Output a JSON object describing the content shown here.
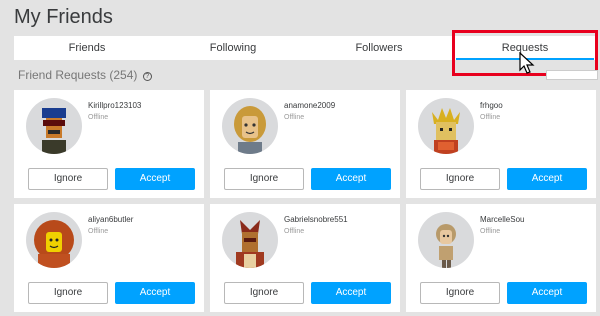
{
  "header": {
    "title": "My Friends"
  },
  "tabs": [
    {
      "label": "Friends"
    },
    {
      "label": "Following"
    },
    {
      "label": "Followers"
    },
    {
      "label": "Requests",
      "active": true
    }
  ],
  "section": {
    "title": "Friend Requests (254)",
    "help_glyph": "?"
  },
  "buttons": {
    "ignore": "Ignore",
    "accept": "Accept"
  },
  "requests": [
    {
      "username": "Kirillpro123103",
      "status": "Offline"
    },
    {
      "username": "anamone2009",
      "status": "Offline"
    },
    {
      "username": "frhgoo",
      "status": "Offline"
    },
    {
      "username": "aliyan6butler",
      "status": "Offline"
    },
    {
      "username": "Gabrielsnobre551",
      "status": "Offline"
    },
    {
      "username": "MarcelleSou",
      "status": "Offline"
    }
  ],
  "colors": {
    "accent": "#00a2ff",
    "highlight": "#e8001e",
    "background": "#e3e3e3"
  }
}
